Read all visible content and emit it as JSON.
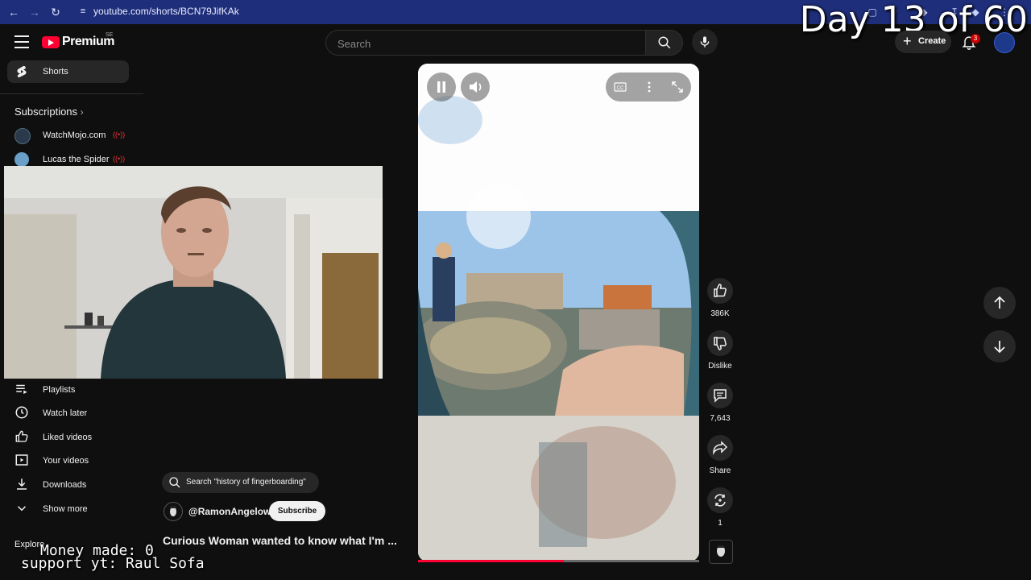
{
  "browser": {
    "url": "youtube.com/shorts/BCN79JifKAk"
  },
  "overlay": {
    "day_counter": "Day 13 of 60",
    "money": "Money made: 0",
    "support": "support yt: Raul Sofa"
  },
  "header": {
    "logo_text": "Premium",
    "logo_region": "SE",
    "search_placeholder": "Search",
    "create_label": "Create",
    "notification_count": "3"
  },
  "sidebar": {
    "shorts_label": "Shorts",
    "subscriptions_label": "Subscriptions",
    "channels": [
      {
        "name": "WatchMojo.com"
      },
      {
        "name": "Lucas the Spider"
      }
    ],
    "items": [
      {
        "label": "Playlists",
        "icon": "playlist-icon"
      },
      {
        "label": "Watch later",
        "icon": "clock-icon"
      },
      {
        "label": "Liked videos",
        "icon": "thumbs-up-icon"
      },
      {
        "label": "Your videos",
        "icon": "play-square-icon"
      },
      {
        "label": "Downloads",
        "icon": "download-icon"
      },
      {
        "label": "Show more",
        "icon": "chevron-down-icon"
      }
    ],
    "explore_label": "Explore"
  },
  "actions": {
    "likes": "386K",
    "dislike_label": "Dislike",
    "comments": "7,643",
    "share_label": "Share",
    "remix_count": "1"
  },
  "video": {
    "related_search": "Search \"history of fingerboarding\"",
    "channel_handle": "@RamonAngelow",
    "subscribe_label": "Subscribe",
    "title": "Curious Woman wanted to know what I'm ...",
    "progress_percent": 52
  },
  "colors": {
    "brand_red": "#ff0033",
    "background": "#0f0f0f",
    "browser_bar": "#1f2e7a"
  }
}
